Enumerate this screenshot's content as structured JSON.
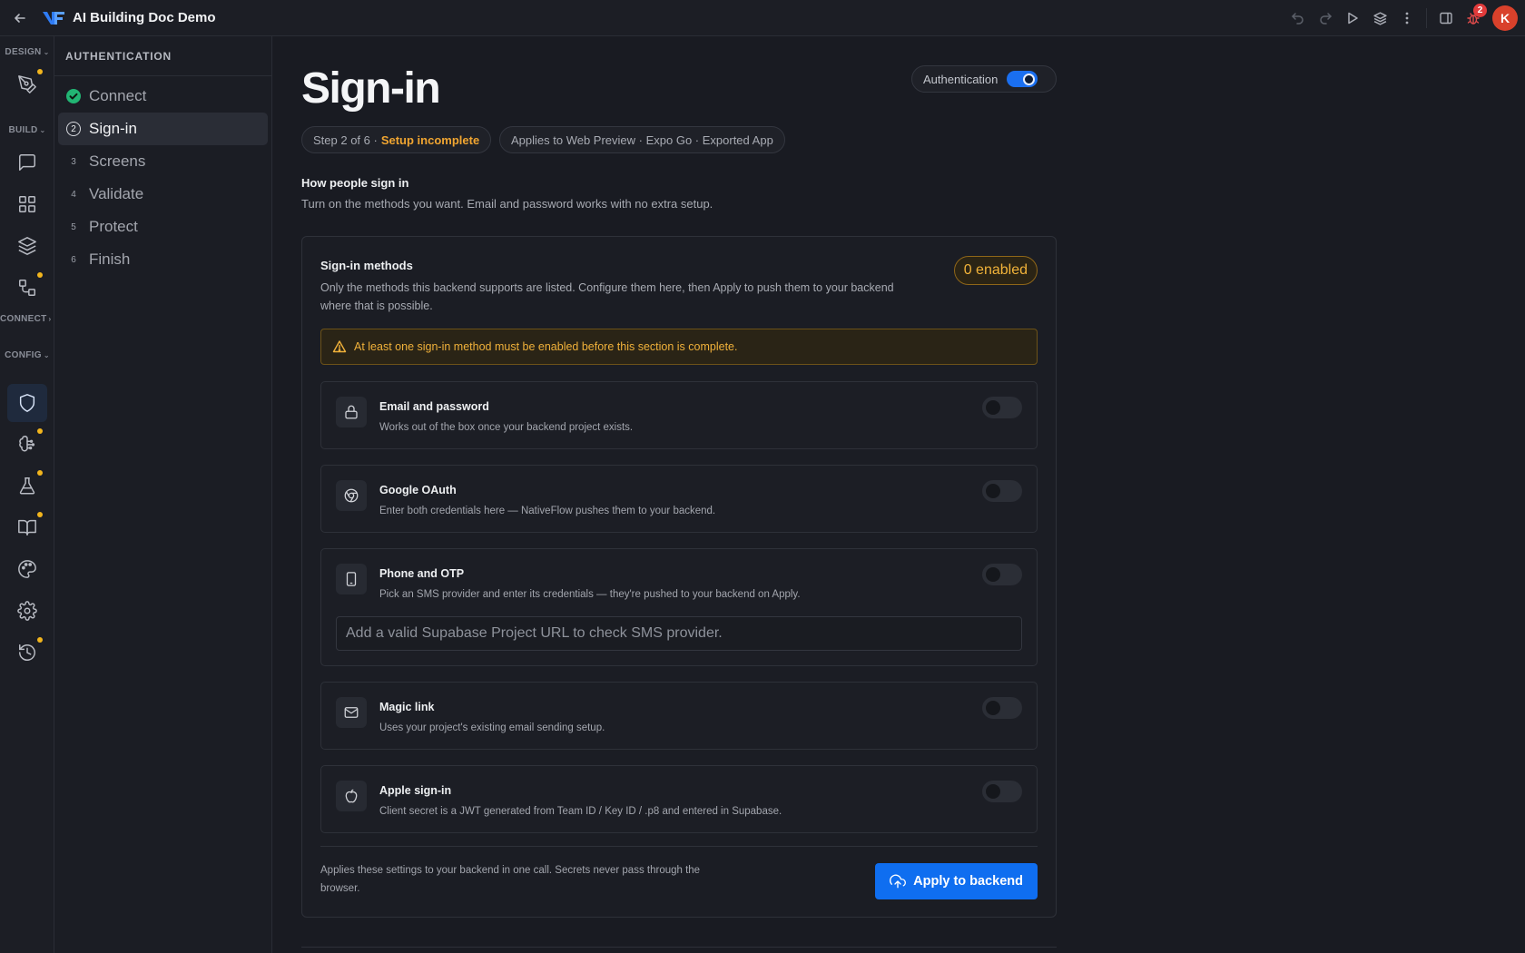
{
  "app": {
    "title": "AI Building Doc Demo"
  },
  "topbar": {
    "notifications_count": "2",
    "avatar_letter": "K"
  },
  "rail": {
    "groups": {
      "design": "DESIGN",
      "build": "BUILD",
      "connect": "CONNECT",
      "config": "CONFIG"
    }
  },
  "steps": {
    "title": "AUTHENTICATION",
    "items": [
      {
        "num": "",
        "label": "Connect"
      },
      {
        "num": "2",
        "label": "Sign-in"
      },
      {
        "num": "3",
        "label": "Screens"
      },
      {
        "num": "4",
        "label": "Validate"
      },
      {
        "num": "5",
        "label": "Protect"
      },
      {
        "num": "6",
        "label": "Finish"
      }
    ]
  },
  "main": {
    "title": "Sign-in",
    "auth_toggle_label": "Authentication",
    "step_chip": {
      "text": "Step 2 of 6 ·",
      "status": "Setup incomplete"
    },
    "applies_chip": "Applies to Web Preview · Expo Go · Exported App",
    "section_title": "How people sign in",
    "section_sub": "Turn on the methods you want. Email and password works with no extra setup."
  },
  "card": {
    "title": "Sign-in methods",
    "desc": "Only the methods this backend supports are listed. Configure them here, then Apply to push them to your backend where that is possible.",
    "enabled_badge": "0 enabled",
    "alert": "At least one sign-in method must be enabled before this section is complete.",
    "methods": [
      {
        "title": "Email and password",
        "desc": "Works out of the box once your backend project exists."
      },
      {
        "title": "Google OAuth",
        "desc": "Enter both credentials here — NativeFlow pushes them to your backend."
      },
      {
        "title": "Phone and OTP",
        "desc": "Pick an SMS provider and enter its credentials — they're pushed to your backend on Apply.",
        "field_placeholder": "Add a valid Supabase Project URL to check SMS provider."
      },
      {
        "title": "Magic link",
        "desc": "Uses your project's existing email sending setup."
      },
      {
        "title": "Apple sign-in",
        "desc": "Client secret is a JWT generated from Team ID / Key ID / .p8 and entered in Supabase."
      }
    ],
    "footer_text": "Applies these settings to your backend in one call. Secrets never pass through the browser.",
    "apply_label": "Apply to backend"
  }
}
